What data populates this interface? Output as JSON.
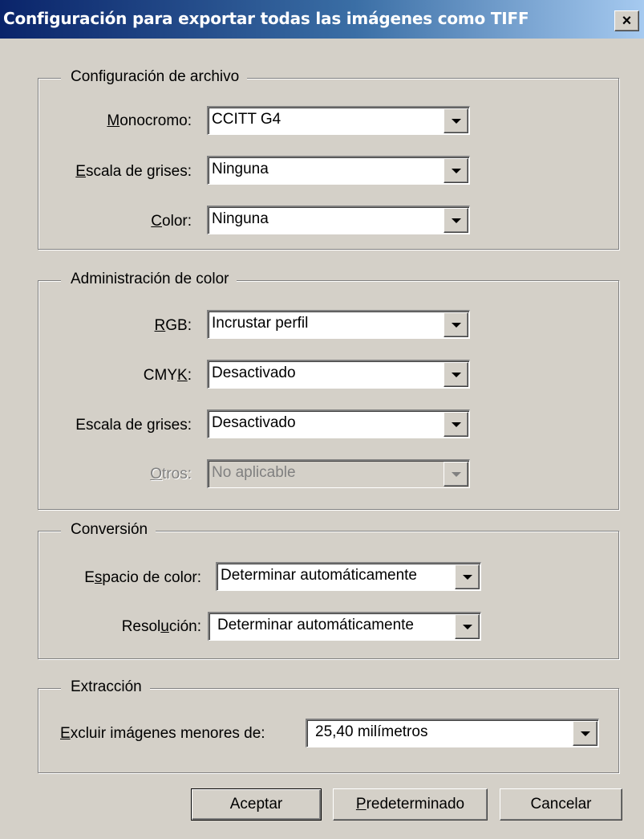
{
  "window": {
    "title": "Configuración para exportar todas las imágenes como TIFF",
    "close_glyph": "×"
  },
  "file_settings": {
    "legend": "Configuración de archivo",
    "rows": [
      {
        "pre": "",
        "key": "M",
        "post": "onocromo:",
        "value": "CCITT G4"
      },
      {
        "pre": "",
        "key": "E",
        "post": "scala de grises:",
        "value": "Ninguna"
      },
      {
        "pre": "",
        "key": "C",
        "post": "olor:",
        "value": "Ninguna"
      }
    ]
  },
  "color_management": {
    "legend": "Administración de color",
    "rows": [
      {
        "pre": "",
        "key": "R",
        "post": "GB:",
        "value": "Incrustar perfil"
      },
      {
        "pre": "CMY",
        "key": "K",
        "post": ":",
        "value": "Desactivado"
      },
      {
        "pre": "Escala de ",
        "key": "g",
        "post": "rises:",
        "value": "Desactivado"
      },
      {
        "pre": "",
        "key": "O",
        "post": "tros:",
        "value": "No aplicable",
        "disabled": true
      }
    ]
  },
  "conversion": {
    "legend": "Conversión",
    "rows": [
      {
        "pre": "E",
        "key": "s",
        "post": "pacio de color:",
        "value": "Determinar automáticamente"
      },
      {
        "pre": "Resol",
        "key": "u",
        "post": "ción:",
        "value": "Determinar automáticamente"
      }
    ]
  },
  "extraction": {
    "legend": "Extracción",
    "rows": [
      {
        "pre": "",
        "key": "E",
        "post": "xcluir imágenes menores de:",
        "value": "25,40 milímetros"
      }
    ]
  },
  "buttons": {
    "ok": "Aceptar",
    "defaults_key": "P",
    "defaults_rest": "redeterminado",
    "cancel": "Cancelar"
  }
}
